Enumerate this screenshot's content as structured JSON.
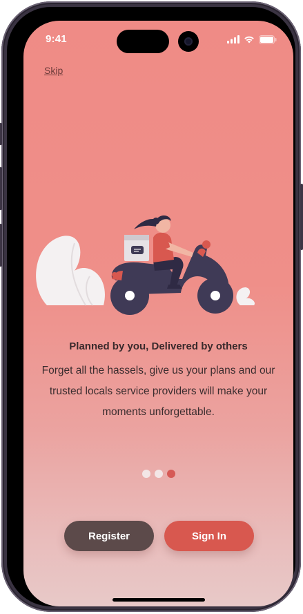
{
  "status_bar": {
    "time": "9:41"
  },
  "onboarding": {
    "skip_label": "Skip",
    "headline": "Planned by you, Delivered by others",
    "body": "Forget all the hassels, give us your plans and our trusted locals service providers will make your moments unforgettable.",
    "illustration": "delivery-scooter-rider-icon",
    "pagination": {
      "total": 3,
      "active_index": 2
    }
  },
  "actions": {
    "register_label": "Register",
    "signin_label": "Sign In"
  },
  "colors": {
    "background_top": "#ef8b86",
    "background_bottom": "#e8c9c8",
    "register_button": "#5c4a4a",
    "signin_button": "#d8584f",
    "active_dot": "#d65a56",
    "inactive_dot": "#f3e6e6"
  }
}
